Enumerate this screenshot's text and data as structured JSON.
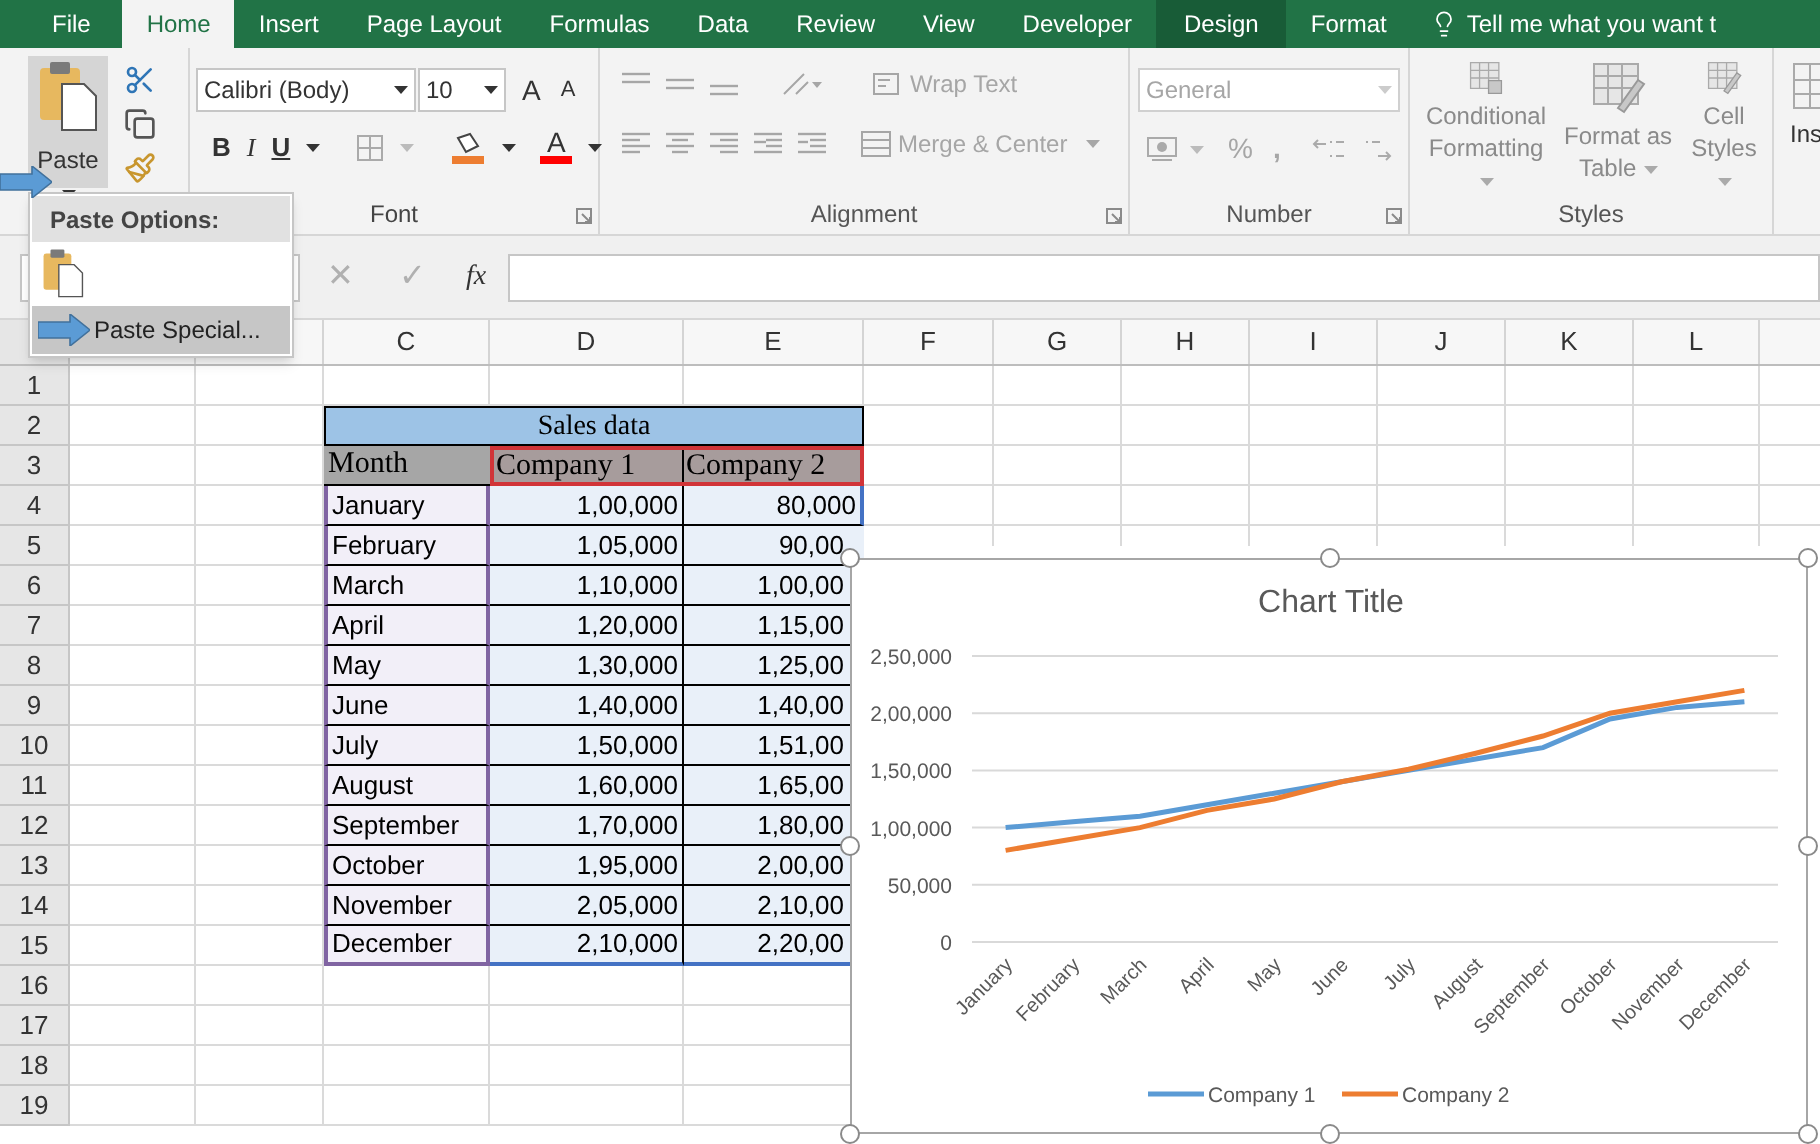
{
  "ribbon_tabs": [
    {
      "label": "File",
      "kind": "file",
      "selected": false
    },
    {
      "label": "Home",
      "kind": "tab",
      "selected": true
    },
    {
      "label": "Insert",
      "kind": "tab",
      "selected": false
    },
    {
      "label": "Page Layout",
      "kind": "tab",
      "selected": false
    },
    {
      "label": "Formulas",
      "kind": "tab",
      "selected": false
    },
    {
      "label": "Data",
      "kind": "tab",
      "selected": false
    },
    {
      "label": "Review",
      "kind": "tab",
      "selected": false
    },
    {
      "label": "View",
      "kind": "tab",
      "selected": false
    },
    {
      "label": "Developer",
      "kind": "tab",
      "selected": false
    },
    {
      "label": "Design",
      "kind": "contextual",
      "selected": false
    },
    {
      "label": "Format",
      "kind": "contextual_plain",
      "selected": false
    }
  ],
  "tell_me": {
    "placeholder": "Tell me what you want t"
  },
  "clipboard": {
    "paste_label": "Paste"
  },
  "font": {
    "family": "Calibri (Body)",
    "size": "10",
    "grow": "A",
    "shrink": "A",
    "bold": "B",
    "italic": "I",
    "underline": "U",
    "color_letter": "A",
    "group_label": "Font",
    "disabled": false
  },
  "alignment": {
    "wrap_text": "Wrap Text",
    "merge": "Merge & Center",
    "group_label": "Alignment",
    "disabled": true
  },
  "number": {
    "format": "General",
    "percent": "%",
    "comma": ",",
    "group_label": "Number",
    "disabled": true
  },
  "styles": {
    "items": [
      {
        "label": "Conditional Formatting"
      },
      {
        "label": "Format as Table"
      },
      {
        "label": "Cell Styles"
      }
    ],
    "group_label": "Styles",
    "disabled": true
  },
  "cells": {
    "insert_label": "Ins"
  },
  "paste_menu": {
    "heading": "Paste Options:",
    "item": "Paste Special..."
  },
  "formula_bar": {
    "cancel": "✕",
    "enter": "✓",
    "function": "fx"
  },
  "sheet": {
    "column_headers": [
      "C",
      "D",
      "E",
      "F",
      "G",
      "H",
      "I",
      "J",
      "K",
      "L"
    ],
    "row_numbers": [
      "1",
      "2",
      "3",
      "4",
      "5",
      "6",
      "7",
      "8",
      "9",
      "10",
      "11",
      "12",
      "13",
      "14",
      "15",
      "16",
      "17",
      "18",
      "19"
    ],
    "table": {
      "title": "Sales data",
      "columns": [
        "Month",
        "Company 1",
        "Company 2"
      ],
      "rows": [
        [
          "January",
          "1,00,000",
          "80,000"
        ],
        [
          "February",
          "1,05,000",
          "90,00"
        ],
        [
          "March",
          "1,10,000",
          "1,00,00"
        ],
        [
          "April",
          "1,20,000",
          "1,15,00"
        ],
        [
          "May",
          "1,30,000",
          "1,25,00"
        ],
        [
          "June",
          "1,40,000",
          "1,40,00"
        ],
        [
          "July",
          "1,50,000",
          "1,51,00"
        ],
        [
          "August",
          "1,60,000",
          "1,65,00"
        ],
        [
          "September",
          "1,70,000",
          "1,80,00"
        ],
        [
          "October",
          "1,95,000",
          "2,00,00"
        ],
        [
          "November",
          "2,05,000",
          "2,10,00"
        ],
        [
          "December",
          "2,10,000",
          "2,20,00"
        ]
      ]
    }
  },
  "chart": {
    "chart_data": {
      "type": "line",
      "title": "Chart Title",
      "categories": [
        "January",
        "February",
        "March",
        "April",
        "May",
        "June",
        "July",
        "August",
        "September",
        "October",
        "November",
        "December"
      ],
      "series": [
        {
          "name": "Company 1",
          "color": "#5b9bd5",
          "values": [
            100000,
            105000,
            110000,
            120000,
            130000,
            140000,
            150000,
            160000,
            170000,
            195000,
            205000,
            210000
          ]
        },
        {
          "name": "Company 2",
          "color": "#ed7d31",
          "values": [
            80000,
            90000,
            100000,
            115000,
            125000,
            140000,
            151000,
            165000,
            180000,
            200000,
            210000,
            220000
          ]
        }
      ],
      "ylim": [
        0,
        250000
      ],
      "grid": true,
      "legend": true,
      "yticks": [
        {
          "value": 0,
          "label": "0"
        },
        {
          "value": 50000,
          "label": "50,000"
        },
        {
          "value": 100000,
          "label": "1,00,000"
        },
        {
          "value": 150000,
          "label": "1,50,000"
        },
        {
          "value": 200000,
          "label": "2,00,000"
        },
        {
          "value": 250000,
          "label": "2,50,000"
        }
      ]
    }
  }
}
